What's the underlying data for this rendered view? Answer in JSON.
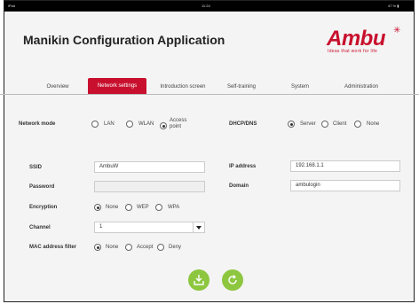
{
  "statusbar": {
    "left": "iPad",
    "center": "11:24",
    "right": "47 % ▮"
  },
  "app": {
    "title": "Manikin Configuration Application"
  },
  "logo": {
    "word": "Ambu",
    "tagline": "Ideas that work for life"
  },
  "tabs": [
    {
      "label": "Overview"
    },
    {
      "label": "Network settings"
    },
    {
      "label": "Introduction screen"
    },
    {
      "label": "Self-training"
    },
    {
      "label": "System"
    },
    {
      "label": "Administration"
    }
  ],
  "network_mode": {
    "label": "Network mode",
    "options": [
      "LAN",
      "WLAN",
      "Access",
      "point"
    ],
    "selected": "Access point"
  },
  "dhcp": {
    "label": "DHCP/DNS",
    "options": [
      "Server",
      "Client",
      "None"
    ],
    "selected": "Server"
  },
  "ssid": {
    "label": "SSID",
    "value": "AmbuW"
  },
  "password": {
    "label": "Password",
    "value": ""
  },
  "encryption": {
    "label": "Encryption",
    "options": [
      "None",
      "WEP",
      "WPA"
    ],
    "selected": "None"
  },
  "channel": {
    "label": "Channel",
    "value": "1"
  },
  "mac_filter": {
    "label": "MAC address filter",
    "options": [
      "None",
      "Accept",
      "Deny"
    ],
    "selected": "None"
  },
  "ip_address": {
    "label": "IP address",
    "value": "192.168.1.1"
  },
  "domain": {
    "label": "Domain",
    "value": "ambulogin"
  },
  "colors": {
    "accent": "#c8102e",
    "action": "#8dc63f"
  },
  "actions": {
    "save_icon": "save-icon",
    "refresh_icon": "refresh-icon"
  }
}
